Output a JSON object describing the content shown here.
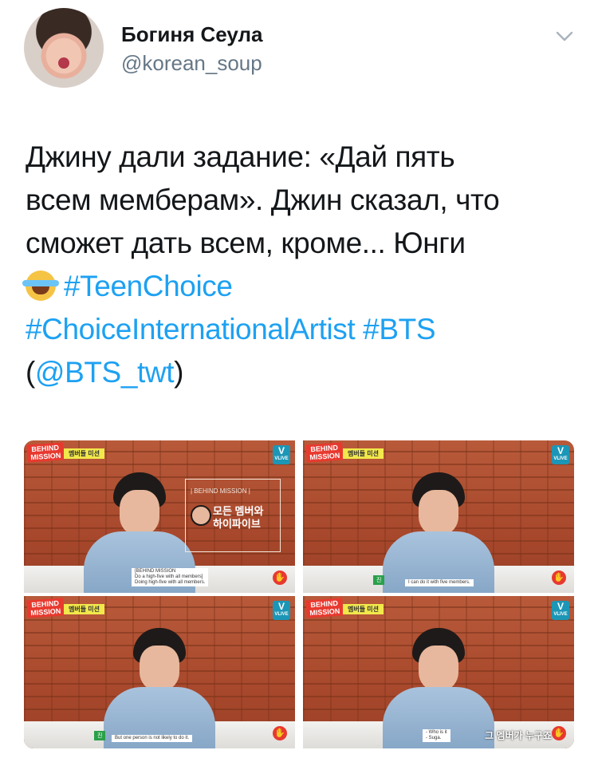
{
  "author": {
    "display_name": "Богиня Сеула",
    "handle": "@korean_soup"
  },
  "icons": {
    "caret": "chevron-down-icon",
    "emoji": "face-with-tears-of-joy"
  },
  "colors": {
    "link": "#1da1f2",
    "text": "#14171a",
    "secondary": "#657786"
  },
  "tweet": {
    "line1": "Джину дали задание: «Дай пять",
    "line2": "всем мемберам». Джин сказал, что",
    "line3": "сможет дать всем, кроме... Юнги",
    "hashtag_teenchoice": "#TeenChoice",
    "hashtag_artist": "#ChoiceInternationalArtist",
    "hashtag_bts": "#BTS",
    "paren_open": "(",
    "mention": "@BTS_twt",
    "paren_close": ")"
  },
  "media": [
    {
      "badge": "BEHIND\nMISSION",
      "mission_tag": "멤버들 미션",
      "vlive": "VLIVE",
      "callout_title": "| BEHIND MISSION |",
      "callout_text": "모든 멤버와\n하이파이브",
      "subtitle": "[BEHIND MISSION\nDo a high-five with all members]\nDoing high-five with all members."
    },
    {
      "badge": "BEHIND\nMISSION",
      "mission_tag": "멤버들 미션",
      "vlive": "VLIVE",
      "tag": "진",
      "subtitle": "I can do it with five members."
    },
    {
      "badge": "BEHIND\nMISSION",
      "mission_tag": "멤버들 미션",
      "vlive": "VLIVE",
      "tag": "진",
      "subtitle": "But one person is not likely to do it."
    },
    {
      "badge": "BEHIND\nMISSION",
      "mission_tag": "멤버들 미션",
      "vlive": "VLIVE",
      "subtitle": "- Who is it\n- Suga.",
      "korean_sub": "그 멤버가 누구죠"
    }
  ]
}
